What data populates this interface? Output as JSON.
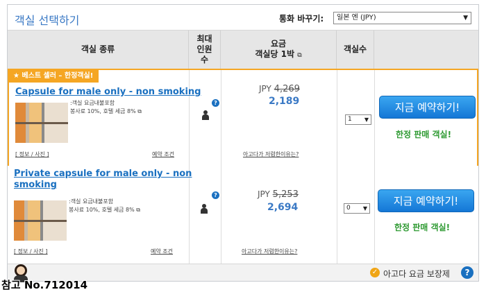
{
  "header": {
    "title": "객실 선택하기",
    "currency_label": "통화 바꾸기:",
    "currency_selected": "일본 엔 (JPY)"
  },
  "columns": {
    "room_type": "객실 종류",
    "max_guests_1": "최대",
    "max_guests_2": "인원",
    "max_guests_3": "수",
    "price_1": "요금",
    "price_2": "객실당 1박",
    "rooms": "객실수"
  },
  "rooms": [
    {
      "badge": "베스트 셀러 – 한정객실!",
      "name_line1": "Capsule for male only - non smoking",
      "name_line2": "",
      "note1": ":객실 요금내불포함",
      "note2": "봉사료 10%, 호텔 세금 8%",
      "info_link": "[ 정보 / 사진 ]",
      "conditions_link": "예약 조건",
      "currency": "JPY",
      "old_price": "4,269",
      "price": "2,189",
      "why_link": "아고다가 저렴한이유는?",
      "qty": "1",
      "book_button": "지금 예약하기!",
      "limited_text": "한정 판매 객실!"
    },
    {
      "badge": "",
      "name_line1": "Private capsule for male only - non",
      "name_line2": "smoking",
      "note1": ":객실 요금내불포함",
      "note2": "봉사료 10%, 호텔 세금 8%",
      "info_link": "[ 정보 / 사진 ]",
      "conditions_link": "예약 조건",
      "currency": "JPY",
      "old_price": "5,253",
      "price": "2,694",
      "why_link": "아고다가 저렴한이유는?",
      "qty": "0",
      "book_button": "지금 예약하기!",
      "limited_text": "한정 판매 객실!"
    }
  ],
  "footer": {
    "guarantee": "아고다 요금 보장제",
    "reference": "참고 No.712014"
  },
  "colors": {
    "accent": "#3a79c5",
    "highlight_border": "#f5a623",
    "book_button": "#1a85e0",
    "limited": "#2e9a32"
  }
}
